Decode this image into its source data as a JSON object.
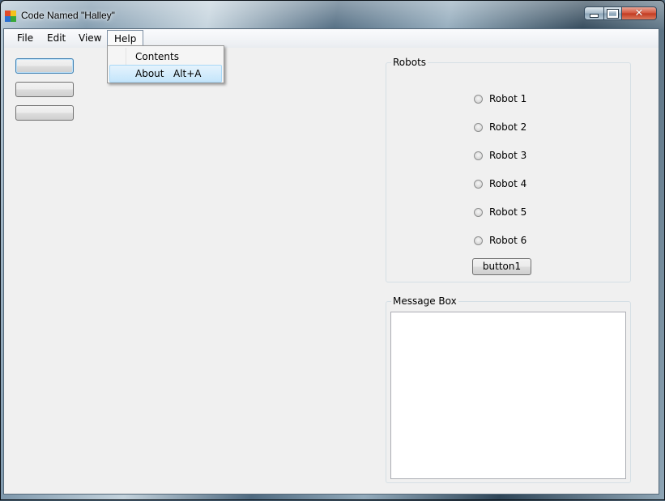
{
  "window": {
    "title": "Code Named \"Halley\"",
    "icon": "app-icon",
    "caption_buttons": {
      "minimize": "minimize-icon",
      "maximize": "maximize-icon",
      "close": "close-icon"
    }
  },
  "menubar": {
    "items": [
      {
        "label": "File"
      },
      {
        "label": "Edit"
      },
      {
        "label": "View"
      },
      {
        "label": "Help",
        "open": true
      }
    ]
  },
  "help_menu": {
    "items": [
      {
        "label": "Contents",
        "shortcut": ""
      },
      {
        "label": "About",
        "shortcut": "Alt+A",
        "highlighted": true
      }
    ]
  },
  "left_buttons": [
    {
      "label": "",
      "focused": true
    },
    {
      "label": ""
    },
    {
      "label": ""
    }
  ],
  "robots_group": {
    "title": "Robots",
    "options": [
      "Robot 1",
      "Robot 2",
      "Robot 3",
      "Robot 4",
      "Robot 5",
      "Robot 6"
    ],
    "button_label": "button1"
  },
  "message_group": {
    "title": "Message Box",
    "text": ""
  },
  "colors": {
    "client_bg": "#f0f0f0",
    "selection_bg": "#c4e5fb",
    "selection_border": "#a8d8f7"
  }
}
